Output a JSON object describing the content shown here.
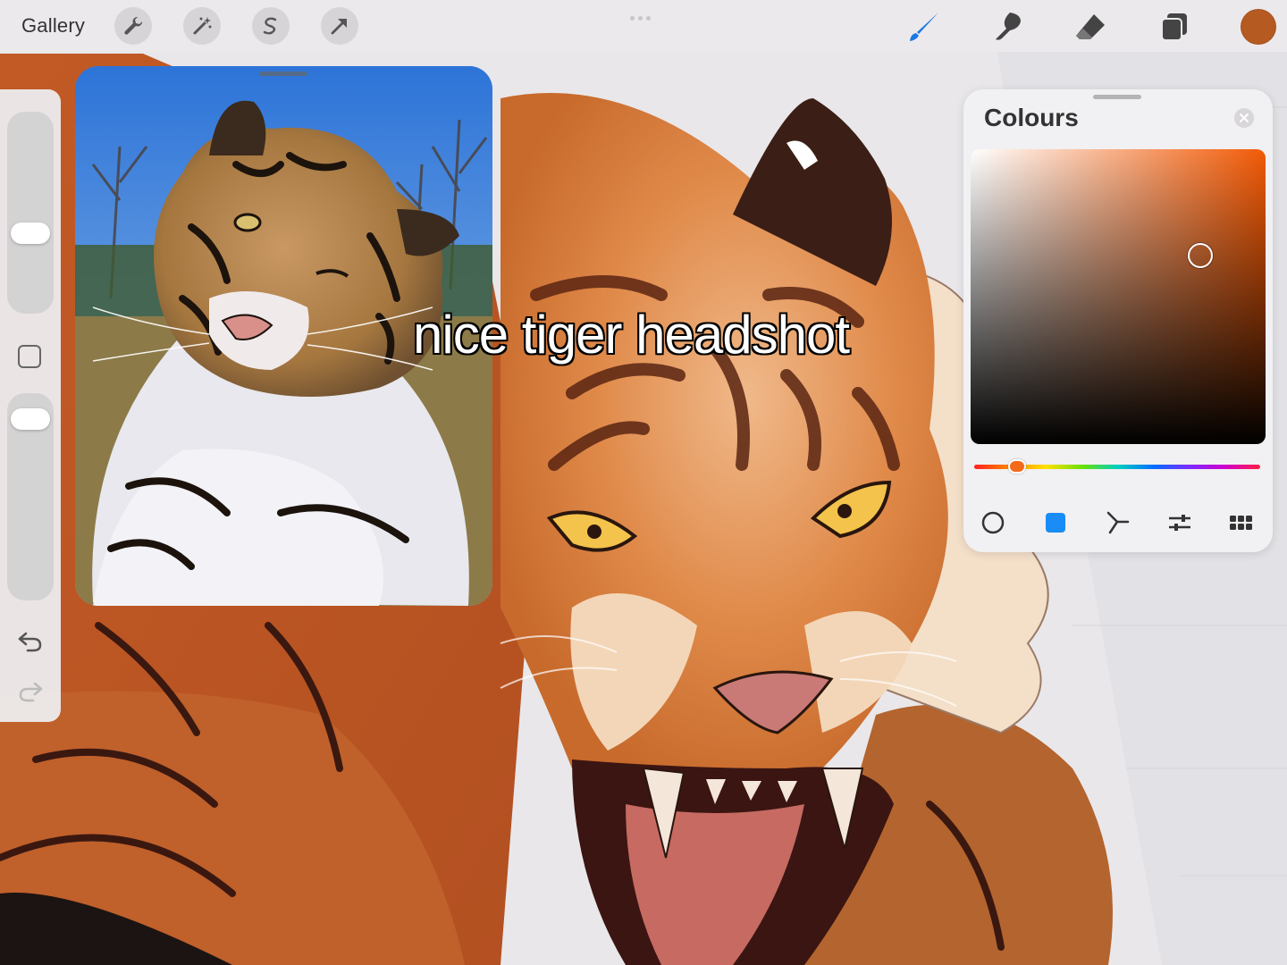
{
  "app": {
    "gallery_label": "Gallery"
  },
  "toolbar": {
    "left_tools": [
      "wrench-icon",
      "magic-wand-icon",
      "selection-s-icon",
      "transform-arrow-icon"
    ],
    "right_tools": [
      "brush-icon",
      "smudge-icon",
      "eraser-icon",
      "layers-icon"
    ],
    "active_tool": "brush-icon",
    "active_tool_color": "#1a78e0",
    "current_color": "#b55a21"
  },
  "sidebar": {
    "brush_size_level": 0.35,
    "opacity_level": 0.08,
    "undo_icon": "undo-arrow-icon",
    "redo_icon": "redo-arrow-icon"
  },
  "caption": {
    "text": "nice tiger headshot"
  },
  "colours_panel": {
    "title": "Colours",
    "selected_hue_color": "#f25a06",
    "selected_color": "#b55a21",
    "modes": [
      "disc-icon",
      "classic-square-icon",
      "harmony-icon",
      "value-sliders-icon",
      "palettes-grid-icon"
    ],
    "active_mode": "classic-square-icon",
    "active_mode_color": "#1a8cf5"
  }
}
